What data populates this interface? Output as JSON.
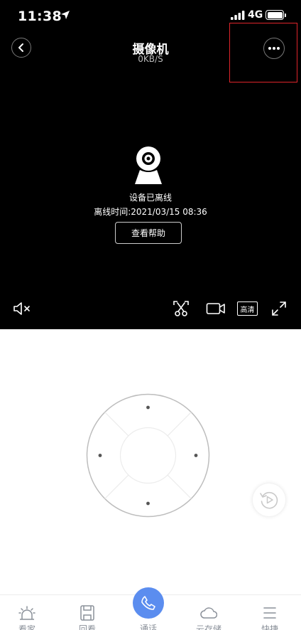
{
  "status_bar": {
    "time": "11:38",
    "network": "4G"
  },
  "header": {
    "title": "摄像机",
    "speed": "0KB/S"
  },
  "offline": {
    "message": "设备已离线",
    "time_text": "离线时间:2021/03/15 08:36",
    "help_label": "查看帮助"
  },
  "controls": {
    "hd_label": "高清"
  },
  "tabs": {
    "home": "看家",
    "playback": "回看",
    "call": "通话",
    "cloud": "云存储",
    "shortcut": "快捷"
  },
  "colors": {
    "accent": "#5b8def",
    "highlight": "#e0252b",
    "video_bg": "#000000"
  }
}
